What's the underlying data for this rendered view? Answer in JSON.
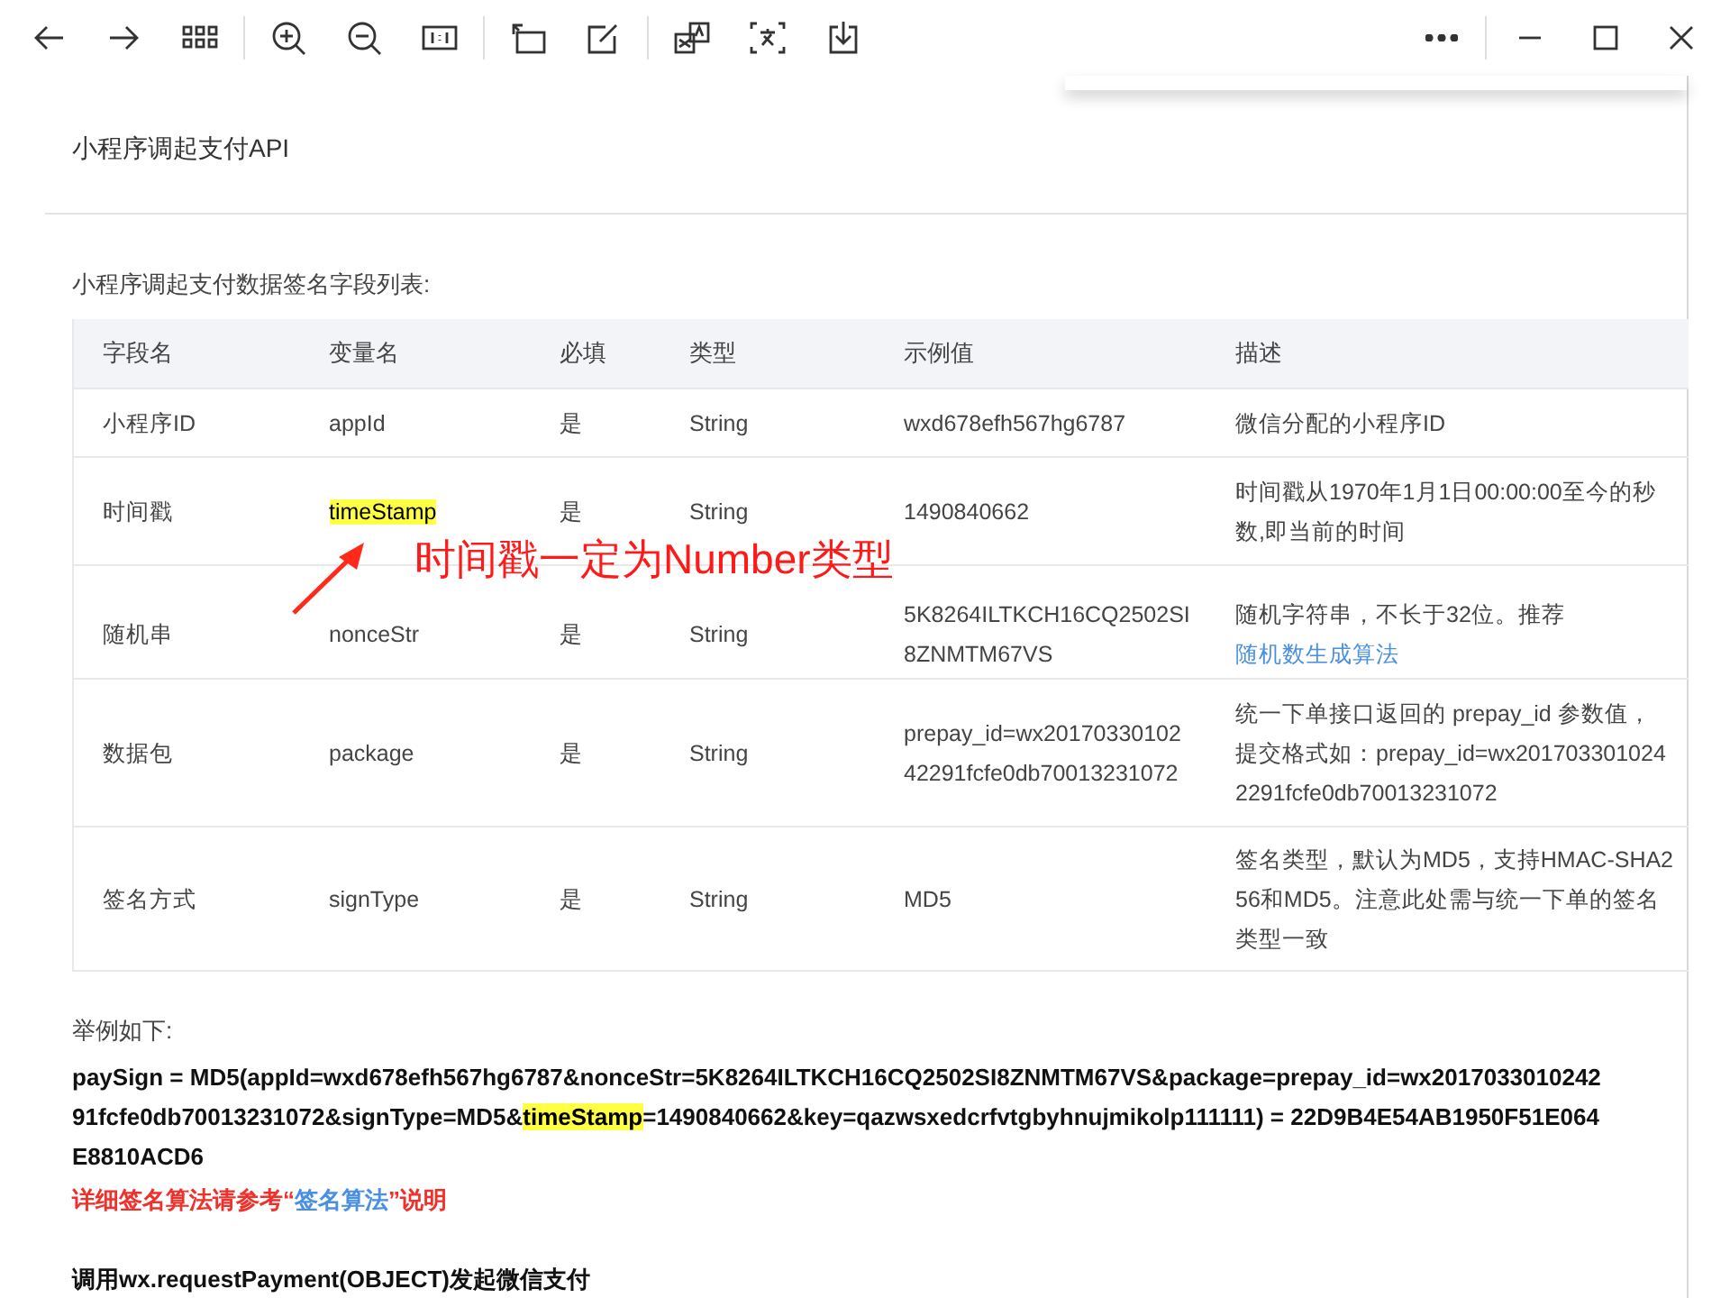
{
  "toolbar": {
    "left": [
      {
        "kind": "back"
      },
      {
        "kind": "forward"
      },
      {
        "kind": "grid"
      },
      {
        "kind": "sep"
      },
      {
        "kind": "zoom-in"
      },
      {
        "kind": "zoom-out"
      },
      {
        "kind": "actual-size"
      },
      {
        "kind": "sep"
      },
      {
        "kind": "rotate"
      },
      {
        "kind": "edit"
      },
      {
        "kind": "sep"
      },
      {
        "kind": "translate"
      },
      {
        "kind": "ocr"
      },
      {
        "kind": "download"
      }
    ],
    "right": [
      {
        "kind": "more"
      },
      {
        "kind": "sep"
      },
      {
        "kind": "minimize"
      },
      {
        "kind": "maximize"
      },
      {
        "kind": "close"
      }
    ]
  },
  "document": {
    "title": "小程序调起支付API",
    "caption": "小程序调起支付数据签名字段列表:",
    "table": {
      "columns": [
        "字段名",
        "变量名",
        "必填",
        "类型",
        "示例值",
        "描述"
      ],
      "rows": [
        {
          "name": "小程序ID",
          "variable": "appId",
          "highlighted": false,
          "required": "是",
          "type": "String",
          "example": "wxd678efh567hg6787",
          "description": "微信分配的小程序ID"
        },
        {
          "name": "时间戳",
          "variable": "timeStamp",
          "highlighted": true,
          "required": "是",
          "type": "String",
          "example": "1490840662",
          "description": "时间戳从1970年1月1日00:00:00至今的秒数,即当前的时间"
        },
        {
          "name": "随机串",
          "variable": "nonceStr",
          "highlighted": false,
          "required": "是",
          "type": "String",
          "example": "5K8264ILTKCH16CQ2502SI8ZNMTM67VS",
          "description": "随机字符串，不长于32位。推荐",
          "description_link": "随机数生成算法"
        },
        {
          "name": "数据包",
          "variable": "package",
          "highlighted": false,
          "required": "是",
          "type": "String",
          "example": "prepay_id=wx2017033010242291fcfe0db70013231072",
          "description": "统一下单接口返回的 prepay_id 参数值，提交格式如：prepay_id=wx2017033010242291fcfe0db70013231072"
        },
        {
          "name": "签名方式",
          "variable": "signType",
          "highlighted": false,
          "required": "是",
          "type": "String",
          "example": "MD5",
          "description": "签名类型，默认为MD5，支持HMAC-SHA256和MD5。注意此处需与统一下单的签名类型一致"
        }
      ]
    },
    "example_label": "举例如下:",
    "example_lines": [
      [
        {
          "text": "paySign = MD5(appId=wxd678efh567hg6787&nonceStr=5K8264ILTKCH16CQ2502SI8ZNMTM67VS&package=prepay_id=wx2017033010242",
          "highlighted": false
        }
      ],
      [
        {
          "text": "91fcfe0db70013231072&signType=MD5&",
          "highlighted": false
        },
        {
          "text": "timeStamp",
          "highlighted": true
        },
        {
          "text": "=1490840662&key=qazwsxedcrfvtgbyhnujmikolp111111) = 22D9B4E54AB1950F51E064",
          "highlighted": false
        }
      ],
      [
        {
          "text": "E8810ACD6",
          "highlighted": false
        }
      ]
    ],
    "note": {
      "before": "详细签名算法请参考“",
      "link": "签名算法",
      "after": "”说明"
    },
    "section_heading": "调用wx.requestPayment(OBJECT)发起微信支付"
  },
  "annotation": {
    "text": "时间戳一定为Number类型"
  }
}
